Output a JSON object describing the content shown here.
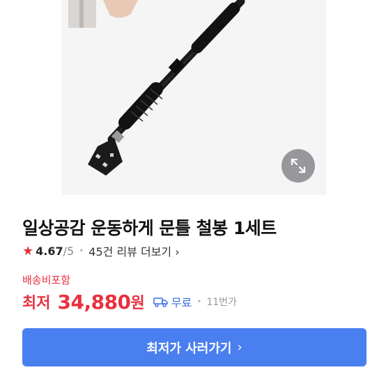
{
  "product": {
    "title": "일상공감 운동하게 문틀 철봉 1세트",
    "rating": "4.67",
    "rating_max": "/5",
    "review_link": "45건 리뷰 더보기",
    "review_chevron": "›"
  },
  "pricing": {
    "shipping_note": "배송비포함",
    "price_prefix": "최저",
    "price": "34,880",
    "price_unit": "원",
    "shipping_fee": "무료",
    "sellers": "11번가"
  },
  "actions": {
    "buy_label": "최저가 사러가기",
    "buy_chevron": "›"
  },
  "icons": {
    "star": "star-icon",
    "zoom": "expand-icon",
    "truck": "truck-icon"
  },
  "colors": {
    "accent_red": "#e83140",
    "link_blue": "#3b6fe0",
    "button_blue": "#4a7ff0"
  }
}
